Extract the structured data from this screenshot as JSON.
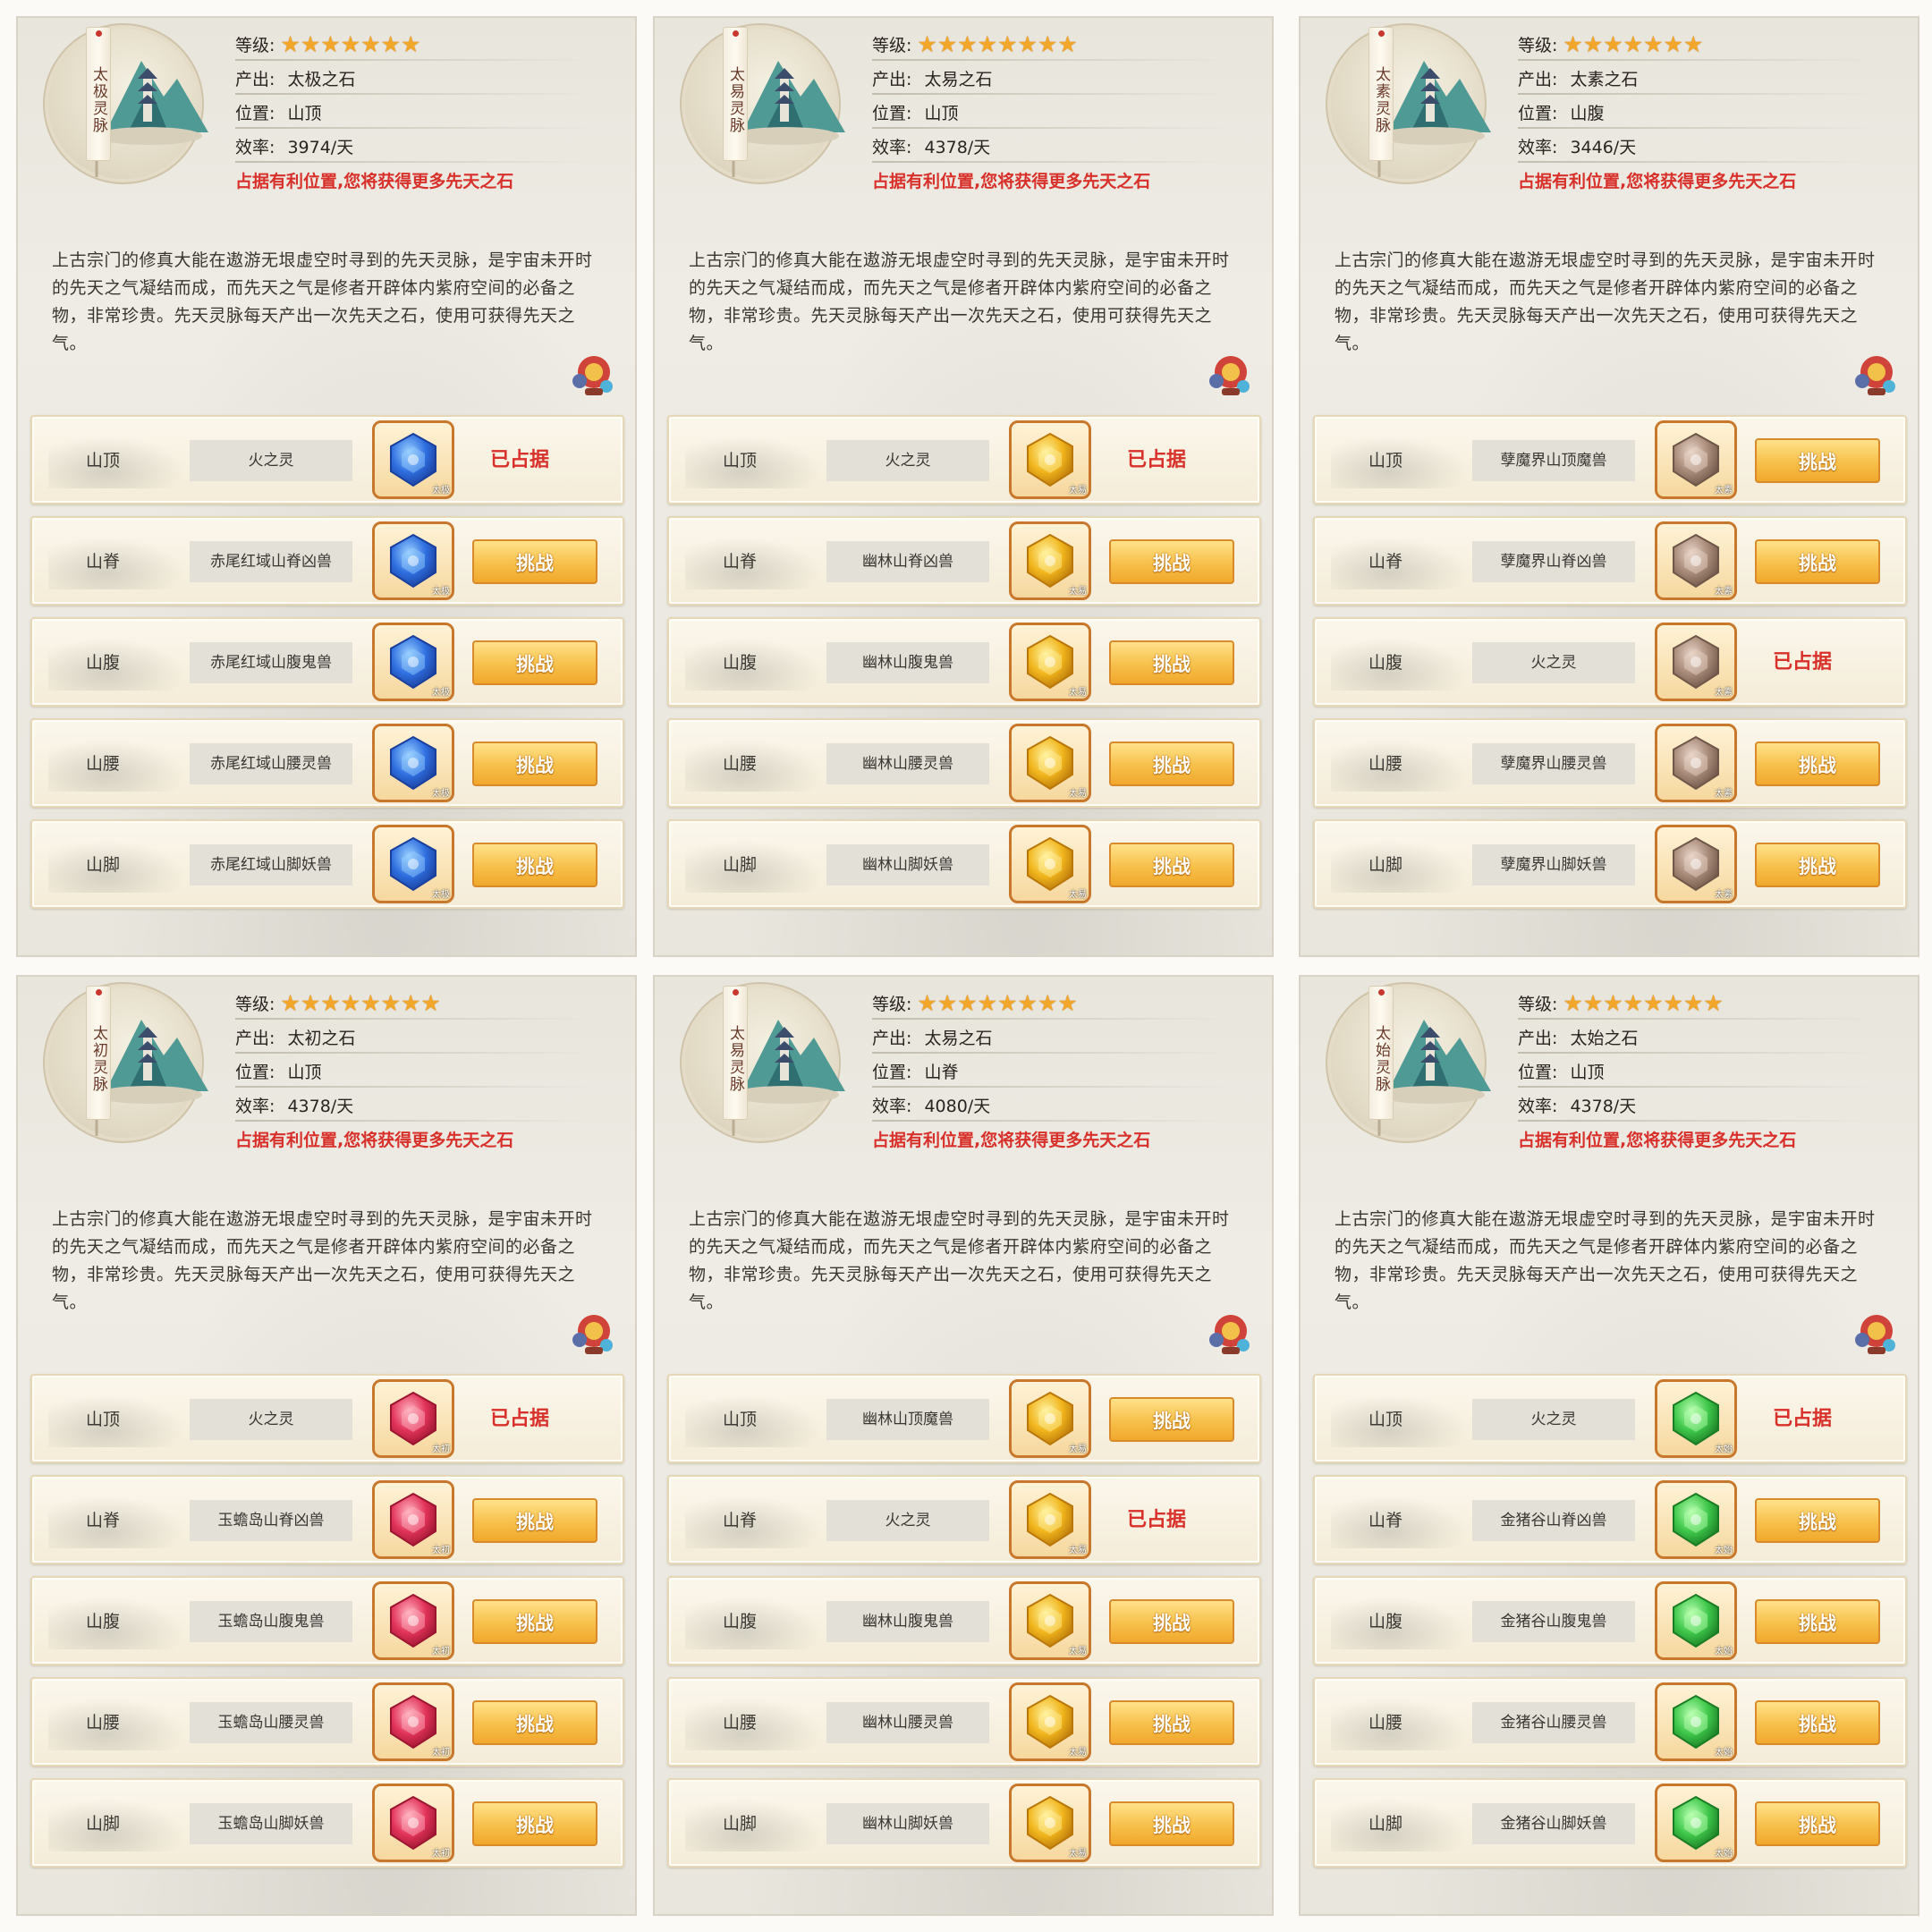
{
  "panels": [
    {
      "tag": "太极灵脉",
      "level_label": "等级:",
      "stars": 7,
      "output_label": "产出:",
      "output": "太极之石",
      "position_label": "位置:",
      "position": "山顶",
      "rate_label": "效率:",
      "rate": "3974/天",
      "tip": "占据有利位置,您将获得更多先天之石",
      "description": "上古宗门的修真大能在遨游无垠虚空时寻到的先天灵脉，是宇宙未开时的先天之气凝结而成，而先天之气是修者开辟体内紫府空间的必备之物，非常珍贵。先天灵脉每天产出一次先天之石，使用可获得先天之气。",
      "gem_color": "blue",
      "rows": [
        {
          "loc": "山顶",
          "target": "火之灵",
          "gem_label": "太极",
          "status": "已占据",
          "action": ""
        },
        {
          "loc": "山脊",
          "target": "赤尾红域山脊凶兽",
          "gem_label": "太极",
          "status": "",
          "action": "挑战"
        },
        {
          "loc": "山腹",
          "target": "赤尾红域山腹鬼兽",
          "gem_label": "太极",
          "status": "",
          "action": "挑战"
        },
        {
          "loc": "山腰",
          "target": "赤尾红域山腰灵兽",
          "gem_label": "太极",
          "status": "",
          "action": "挑战"
        },
        {
          "loc": "山脚",
          "target": "赤尾红域山脚妖兽",
          "gem_label": "太极",
          "status": "",
          "action": "挑战"
        }
      ]
    },
    {
      "tag": "太易灵脉",
      "level_label": "等级:",
      "stars": 8,
      "output_label": "产出:",
      "output": "太易之石",
      "position_label": "位置:",
      "position": "山顶",
      "rate_label": "效率:",
      "rate": "4378/天",
      "tip": "占据有利位置,您将获得更多先天之石",
      "description": "上古宗门的修真大能在遨游无垠虚空时寻到的先天灵脉，是宇宙未开时的先天之气凝结而成，而先天之气是修者开辟体内紫府空间的必备之物，非常珍贵。先天灵脉每天产出一次先天之石，使用可获得先天之气。",
      "gem_color": "gold",
      "rows": [
        {
          "loc": "山顶",
          "target": "火之灵",
          "gem_label": "太易",
          "status": "已占据",
          "action": ""
        },
        {
          "loc": "山脊",
          "target": "幽林山脊凶兽",
          "gem_label": "太易",
          "status": "",
          "action": "挑战"
        },
        {
          "loc": "山腹",
          "target": "幽林山腹鬼兽",
          "gem_label": "太易",
          "status": "",
          "action": "挑战"
        },
        {
          "loc": "山腰",
          "target": "幽林山腰灵兽",
          "gem_label": "太易",
          "status": "",
          "action": "挑战"
        },
        {
          "loc": "山脚",
          "target": "幽林山脚妖兽",
          "gem_label": "太易",
          "status": "",
          "action": "挑战"
        }
      ]
    },
    {
      "tag": "太素灵脉",
      "level_label": "等级:",
      "stars": 7,
      "output_label": "产出:",
      "output": "太素之石",
      "position_label": "位置:",
      "position": "山腹",
      "rate_label": "效率:",
      "rate": "3446/天",
      "tip": "占据有利位置,您将获得更多先天之石",
      "description": "上古宗门的修真大能在遨游无垠虚空时寻到的先天灵脉，是宇宙未开时的先天之气凝结而成，而先天之气是修者开辟体内紫府空间的必备之物，非常珍贵。先天灵脉每天产出一次先天之石，使用可获得先天之气。",
      "gem_color": "brown",
      "rows": [
        {
          "loc": "山顶",
          "target": "孽魔界山顶魔兽",
          "gem_label": "太素",
          "status": "",
          "action": "挑战"
        },
        {
          "loc": "山脊",
          "target": "孽魔界山脊凶兽",
          "gem_label": "太素",
          "status": "",
          "action": "挑战"
        },
        {
          "loc": "山腹",
          "target": "火之灵",
          "gem_label": "太素",
          "status": "已占据",
          "action": ""
        },
        {
          "loc": "山腰",
          "target": "孽魔界山腰灵兽",
          "gem_label": "太素",
          "status": "",
          "action": "挑战"
        },
        {
          "loc": "山脚",
          "target": "孽魔界山脚妖兽",
          "gem_label": "太素",
          "status": "",
          "action": "挑战"
        }
      ]
    },
    {
      "tag": "太初灵脉",
      "level_label": "等级:",
      "stars": 8,
      "output_label": "产出:",
      "output": "太初之石",
      "position_label": "位置:",
      "position": "山顶",
      "rate_label": "效率:",
      "rate": "4378/天",
      "tip": "占据有利位置,您将获得更多先天之石",
      "description": "上古宗门的修真大能在遨游无垠虚空时寻到的先天灵脉，是宇宙未开时的先天之气凝结而成，而先天之气是修者开辟体内紫府空间的必备之物，非常珍贵。先天灵脉每天产出一次先天之石，使用可获得先天之气。",
      "gem_color": "red",
      "rows": [
        {
          "loc": "山顶",
          "target": "火之灵",
          "gem_label": "太初",
          "status": "已占据",
          "action": ""
        },
        {
          "loc": "山脊",
          "target": "玉蟾岛山脊凶兽",
          "gem_label": "太初",
          "status": "",
          "action": "挑战"
        },
        {
          "loc": "山腹",
          "target": "玉蟾岛山腹鬼兽",
          "gem_label": "太初",
          "status": "",
          "action": "挑战"
        },
        {
          "loc": "山腰",
          "target": "玉蟾岛山腰灵兽",
          "gem_label": "太初",
          "status": "",
          "action": "挑战"
        },
        {
          "loc": "山脚",
          "target": "玉蟾岛山脚妖兽",
          "gem_label": "太初",
          "status": "",
          "action": "挑战"
        }
      ]
    },
    {
      "tag": "太易灵脉",
      "level_label": "等级:",
      "stars": 8,
      "output_label": "产出:",
      "output": "太易之石",
      "position_label": "位置:",
      "position": "山脊",
      "rate_label": "效率:",
      "rate": "4080/天",
      "tip": "占据有利位置,您将获得更多先天之石",
      "description": "上古宗门的修真大能在遨游无垠虚空时寻到的先天灵脉，是宇宙未开时的先天之气凝结而成，而先天之气是修者开辟体内紫府空间的必备之物，非常珍贵。先天灵脉每天产出一次先天之石，使用可获得先天之气。",
      "gem_color": "gold",
      "rows": [
        {
          "loc": "山顶",
          "target": "幽林山顶魔兽",
          "gem_label": "太易",
          "status": "",
          "action": "挑战"
        },
        {
          "loc": "山脊",
          "target": "火之灵",
          "gem_label": "太易",
          "status": "已占据",
          "action": ""
        },
        {
          "loc": "山腹",
          "target": "幽林山腹鬼兽",
          "gem_label": "太易",
          "status": "",
          "action": "挑战"
        },
        {
          "loc": "山腰",
          "target": "幽林山腰灵兽",
          "gem_label": "太易",
          "status": "",
          "action": "挑战"
        },
        {
          "loc": "山脚",
          "target": "幽林山脚妖兽",
          "gem_label": "太易",
          "status": "",
          "action": "挑战"
        }
      ]
    },
    {
      "tag": "太始灵脉",
      "level_label": "等级:",
      "stars": 8,
      "output_label": "产出:",
      "output": "太始之石",
      "position_label": "位置:",
      "position": "山顶",
      "rate_label": "效率:",
      "rate": "4378/天",
      "tip": "占据有利位置,您将获得更多先天之石",
      "description": "上古宗门的修真大能在遨游无垠虚空时寻到的先天灵脉，是宇宙未开时的先天之气凝结而成，而先天之气是修者开辟体内紫府空间的必备之物，非常珍贵。先天灵脉每天产出一次先天之石，使用可获得先天之气。",
      "gem_color": "green",
      "rows": [
        {
          "loc": "山顶",
          "target": "火之灵",
          "gem_label": "太始",
          "status": "已占据",
          "action": ""
        },
        {
          "loc": "山脊",
          "target": "金猪谷山脊凶兽",
          "gem_label": "太始",
          "status": "",
          "action": "挑战"
        },
        {
          "loc": "山腹",
          "target": "金猪谷山腹鬼兽",
          "gem_label": "太始",
          "status": "",
          "action": "挑战"
        },
        {
          "loc": "山腰",
          "target": "金猪谷山腰灵兽",
          "gem_label": "太始",
          "status": "",
          "action": "挑战"
        },
        {
          "loc": "山脚",
          "target": "金猪谷山脚妖兽",
          "gem_label": "太始",
          "status": "",
          "action": "挑战"
        }
      ]
    }
  ],
  "gem_colors": {
    "blue": [
      "#9ad0ff",
      "#2f6fe0",
      "#1a3f9c"
    ],
    "gold": [
      "#fff2a0",
      "#f1b51c",
      "#b9770a"
    ],
    "brown": [
      "#e8d4c8",
      "#a88a78",
      "#6e5648"
    ],
    "red": [
      "#ffb3c0",
      "#e2335a",
      "#9c1530"
    ],
    "green": [
      "#b8ffb0",
      "#3ec74a",
      "#1a7c24"
    ]
  },
  "icons": {
    "star": "star-icon",
    "gem": "spirit-stone-icon",
    "pet": "treasure-pet-icon",
    "emblem": "mountain-pagoda-emblem"
  }
}
